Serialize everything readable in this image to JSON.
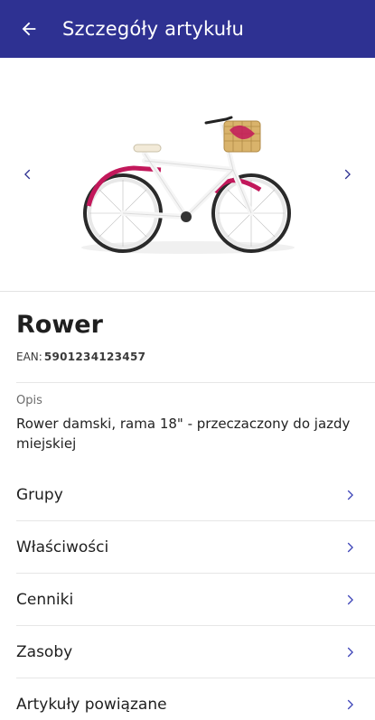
{
  "appbar": {
    "title": "Szczegóły artykułu",
    "back_icon": "arrow-left-icon"
  },
  "gallery": {
    "prev_icon": "chevron-left-icon",
    "next_icon": "chevron-right-icon",
    "image": "bicycle-photo"
  },
  "product": {
    "name": "Rower",
    "ean_label": "EAN:",
    "ean_value": "5901234123457",
    "description_label": "Opis",
    "description": "Rower damski, rama 18\" - przeczaczony do jazdy miejskiej"
  },
  "menu": [
    {
      "label": "Grupy"
    },
    {
      "label": "Właściwości"
    },
    {
      "label": "Cenniki"
    },
    {
      "label": "Zasoby"
    },
    {
      "label": "Artykuły powiązane"
    }
  ],
  "colors": {
    "primary": "#2e3192",
    "accent_chevron": "#3d44b8",
    "frame_pink": "#c2185b"
  }
}
